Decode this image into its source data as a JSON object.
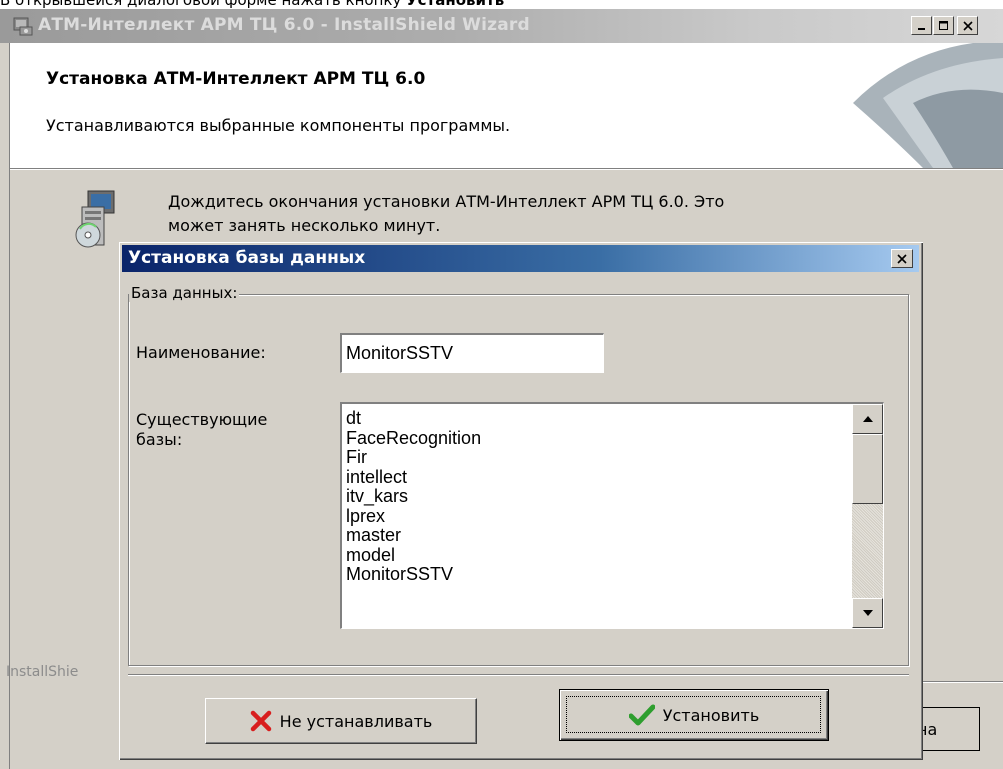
{
  "caption": {
    "prefix": "В открывшейся диалоговой форме нажать кнопку ",
    "emphasis": "Установить"
  },
  "main_window": {
    "title": "АТМ-Интеллект АРМ ТЦ 6.0 - InstallShield Wizard",
    "header_title": "Установка АТМ-Интеллект АРМ ТЦ 6.0",
    "header_subtitle": "Устанавливаются выбранные компоненты программы.",
    "body_line1": "Дождитесь окончания установки АТМ-Интеллект АРМ ТЦ 6.0. Это",
    "body_line2": "может занять несколько минут.",
    "installshield_label": "InstallShie",
    "behind_button_text": "на"
  },
  "dialog": {
    "title": "Установка базы данных",
    "group_label": "База данных:",
    "name_label": "Наименование:",
    "name_value": "MonitorSSTV",
    "existing_label": "Существующие базы:",
    "databases": [
      "dt",
      "FaceRecognition",
      "Fir",
      "intellect",
      "itv_kars",
      "lprex",
      "master",
      "model",
      "MonitorSSTV"
    ],
    "cancel_button": "Не устанавливать",
    "install_button": "Установить"
  },
  "icons": {
    "app": "installer-app-icon",
    "install": "computer-cd-icon",
    "cancel": "red-x-icon",
    "ok": "green-check-icon"
  },
  "colors": {
    "dialog_title_start": "#0a246a",
    "dialog_title_end": "#a6caf0",
    "window_face": "#d4d0c8"
  }
}
